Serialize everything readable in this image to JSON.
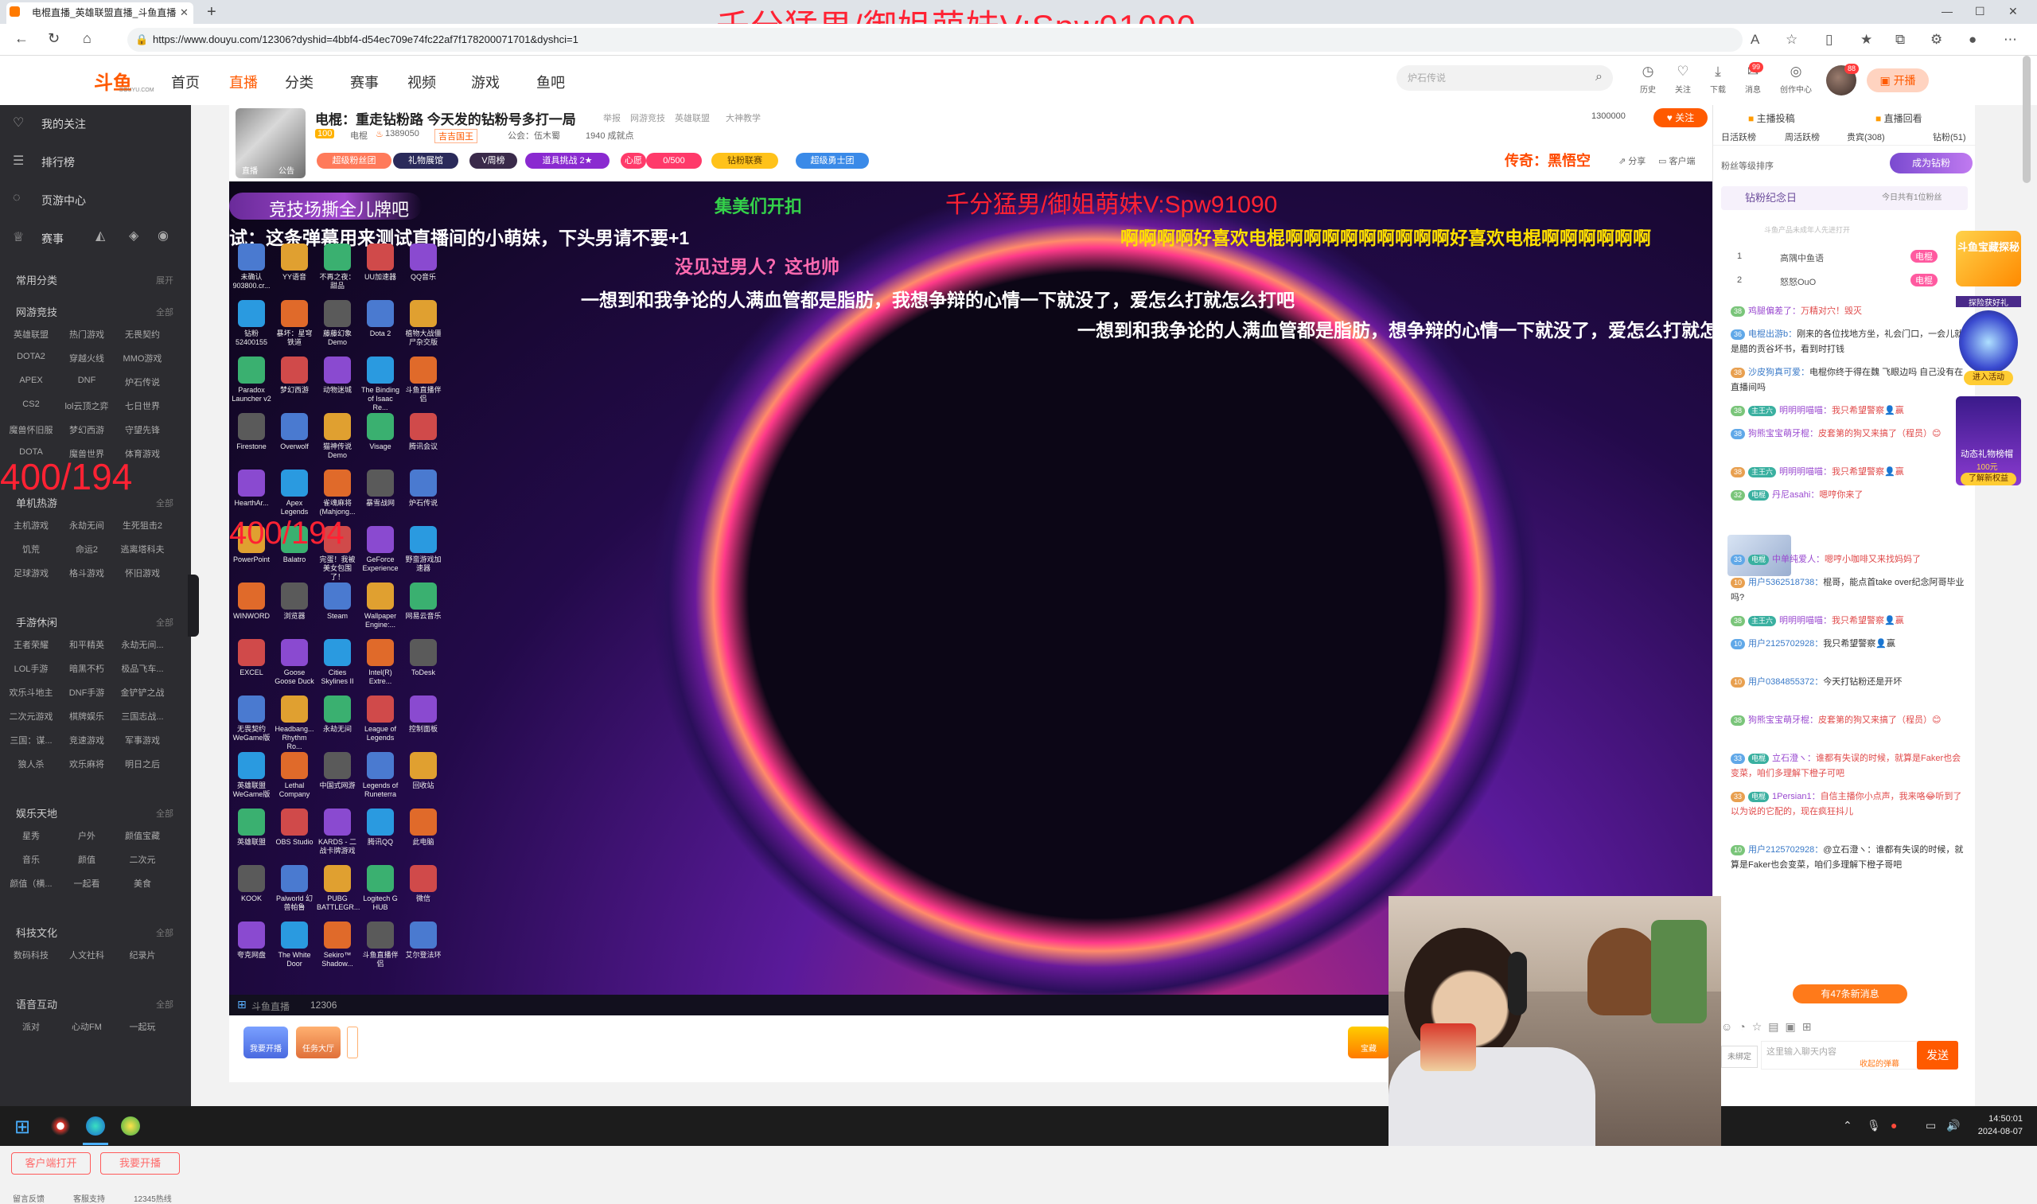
{
  "browser": {
    "tab_title": "电棍直播_英雄联盟直播_斗鱼直播",
    "url": "https://www.douyu.com/12306?dyshid=4bbf4-d54ec709e74fc22af7f178200071701&dyshci=1",
    "overlay_banner": "千分猛男/御姐萌妹V:Spw91090"
  },
  "site": {
    "logo": "斗鱼",
    "logo_sub": "DOUYU.COM",
    "nav": [
      "首页",
      "直播",
      "分类",
      "赛事",
      "视频",
      "游戏",
      "鱼吧"
    ],
    "search_placeholder": "炉石传说",
    "header_icons": [
      {
        "label": "历史",
        "icon": "clock-icon"
      },
      {
        "label": "关注",
        "icon": "heart-icon"
      },
      {
        "label": "下载",
        "icon": "download-icon"
      },
      {
        "label": "消息",
        "icon": "message-icon",
        "badge": "99"
      },
      {
        "label": "创作中心",
        "icon": "creator-icon"
      }
    ],
    "avatar_badge": "88",
    "start_live": "开播"
  },
  "sidebar": {
    "top_items": [
      {
        "label": "我的关注",
        "icon": "heart-icon"
      },
      {
        "label": "排行榜",
        "icon": "rank-icon"
      },
      {
        "label": "页游中心",
        "icon": "game-center-icon"
      },
      {
        "label": "赛事",
        "icon": "trophy-icon"
      }
    ],
    "common": {
      "title": "常用分类",
      "all": "展开"
    },
    "sections": [
      {
        "title": "网游竞技",
        "all": "全部",
        "items": [
          "英雄联盟",
          "热门游戏",
          "无畏契约",
          "DOTA2",
          "穿越火线",
          "MMO游戏",
          "APEX",
          "DNF",
          "炉石传说",
          "CS2",
          "lol云顶之弈",
          "七日世界",
          "魔兽怀旧服",
          "梦幻西游",
          "守望先锋",
          "DOTA",
          "魔兽世界",
          "体育游戏"
        ]
      },
      {
        "title": "单机热游",
        "all": "全部",
        "items": [
          "主机游戏",
          "永劫无间",
          "生死狙击2",
          "饥荒",
          "命运2",
          "逃离塔科夫",
          "足球游戏",
          "格斗游戏",
          "怀旧游戏"
        ]
      },
      {
        "title": "手游休闲",
        "all": "全部",
        "items": [
          "王者荣耀",
          "和平精英",
          "永劫无间...",
          "LOL手游",
          "暗黑不朽",
          "极品飞车...",
          "欢乐斗地主",
          "DNF手游",
          "金铲铲之战",
          "二次元游戏",
          "棋牌娱乐",
          "三国志战...",
          "三国：谋...",
          "竞速游戏",
          "军事游戏",
          "狼人杀",
          "欢乐麻将",
          "明日之后"
        ]
      },
      {
        "title": "娱乐天地",
        "all": "全部",
        "items": [
          "星秀",
          "户外",
          "颜值宝藏",
          "音乐",
          "颜值",
          "二次元",
          "颜值（横...",
          "一起看",
          "美食"
        ]
      },
      {
        "title": "科技文化",
        "all": "全部",
        "items": [
          "数码科技",
          "人文社科",
          "纪录片"
        ]
      },
      {
        "title": "语音互动",
        "all": "全部",
        "items": [
          "派对",
          "心动FM",
          "一起玩"
        ]
      }
    ],
    "red_overlay_1": "400/194",
    "red_overlay_2": "400/194",
    "btn_client": "客户端打开",
    "btn_start": "我要开播",
    "footer": [
      "留言反馈",
      "客服支持",
      "12345热线"
    ]
  },
  "room": {
    "title": "电棍：重走钻粉路 今天发的钻粉号多打一局",
    "report": "举报",
    "tags": [
      "网游竞技",
      "英雄联盟",
      "大神教学"
    ],
    "level": "100",
    "name": "电棍",
    "heat": "1389050",
    "guild": "吉吉国王",
    "notice": "公会：伍木蜀",
    "achievement": "1940 成就点",
    "thumb_labels": [
      "直播",
      "公告"
    ],
    "pills": [
      "超级粉丝团",
      "礼物展馆",
      "V周榜",
      "道具挑战 2★",
      "心愿",
      "0/500",
      "钻粉联赛",
      "超级勇士团"
    ],
    "followers": "1300000",
    "follow_btn": "关注",
    "legend_tag": "传奇：黑悟空",
    "share": "分享",
    "client": "客户端"
  },
  "video": {
    "banner": "竞技场撕全儿牌吧",
    "header_text": "集美们开扣",
    "title_overlay": "千分猛男/御姐萌妹V:Spw91090",
    "danmu": [
      {
        "text": "试：这条弹幕用来测试直播间的小萌妹，下头男请不要+1",
        "color": "#ffffff"
      },
      {
        "text": "啊啊啊啊好喜欢电棍啊啊啊啊啊啊啊啊啊好喜欢电棍啊啊啊啊啊啊",
        "color": "#ffe000"
      },
      {
        "text": "没见过男人？这也帅",
        "color": "#ff6ab0"
      },
      {
        "text": "一想到和我争论的人满血管都是脂肪，我想争辩的心情一下就没了，爱怎么打就怎么打吧",
        "color": "#ffffff"
      },
      {
        "text": "一想到和我争论的人满血管都是脂肪，想争辩的心情一下就没了，爱怎么打就怎么打吧",
        "color": "#ffffff"
      }
    ],
    "desktop_icons": [
      [
        "未确认 903800.cr...",
        "YY语音",
        "不再之夜：甜品",
        "UU加速器",
        "QQ音乐"
      ],
      [
        "钻粉 52400155",
        "暴坏：星穹铁道",
        "藤藤幻象 Demo",
        "Dota 2",
        "植物大战僵尸杂交版"
      ],
      [
        "Paradox Launcher v2",
        "梦幻西游",
        "动物迷城",
        "The Binding of Isaac Re...",
        "斗鱼直播伴侣"
      ],
      [
        "Firestone",
        "Overwolf",
        "猫神传说 Demo",
        "Visage",
        "腾讯会议"
      ],
      [
        "HearthAr...",
        "Apex Legends",
        "雀魂麻将 (Mahjong...",
        "暴雪战网",
        "炉石传说"
      ],
      [
        "PowerPoint",
        "Balatro",
        "完蛋！我被美女包围了！",
        "GeForce Experience",
        "野蛮游戏加速器"
      ],
      [
        "WINWORD",
        "浏览器",
        "Steam",
        "Wallpaper Engine:...",
        "网易云音乐"
      ],
      [
        "EXCEL",
        "Goose Goose Duck",
        "Cities Skylines II",
        "Intel(R) Extre...",
        "ToDesk"
      ],
      [
        "无畏契约 WeGame版",
        "Headbang... Rhythm Ro...",
        "永劫无间",
        "League of Legends",
        "控制面板"
      ],
      [
        "英雄联盟 WeGame版",
        "Lethal Company",
        "中国式网游",
        "Legends of Runeterra",
        "回收站"
      ],
      [
        "英雄联盟",
        "OBS Studio",
        "KARDS - 二战卡牌游戏",
        "腾讯QQ",
        "此电脑"
      ],
      [
        "KOOK",
        "Palworld 幻兽帕鲁",
        "PUBG BATTLEGR...",
        "Logitech G HUB",
        "微信"
      ],
      [
        "夸克网盘",
        "The White Door",
        "Sekiro™ Shadow...",
        "斗鱼直播伴侣",
        "艾尔登法环"
      ]
    ],
    "inner_taskbar_text": "12306",
    "inner_taskbar_label": "斗鱼直播"
  },
  "below_video": {
    "btn1": "我要开播",
    "btn2": "任务大厅",
    "right_tag": "宝藏"
  },
  "right": {
    "top_links": [
      "主播投稿",
      "直播回看"
    ],
    "tabs": [
      "日活跃榜",
      "周活跃榜",
      "贵宾(308)",
      "钻粉(51)"
    ],
    "fan_sort": "粉丝等级排序",
    "fan_btn": "成为钻粉",
    "memorial": "钻粉纪念日",
    "memorial_sub": "今日共有1位粉丝",
    "entering": "斗鱼产品未成年人先进打开",
    "ranks": [
      {
        "n": "1",
        "name": "高隅中鱼语",
        "tag": "电棍"
      },
      {
        "n": "2",
        "name": "怒怒OuO",
        "tag": "电棍"
      }
    ],
    "chat": [
      {
        "lv": "38",
        "name": "鸡腿偏差了：",
        "msg": "万精对穴！毁灭",
        "cls": "msg"
      },
      {
        "lv": "36",
        "name": "电棍出游b：",
        "msg": "刚来的各位找地方坐，礼会门口，一会儿就是腊的贡谷坏书，看到时打钱",
        "cls": "msgb"
      },
      {
        "lv": "38",
        "name": "沙皮狗真可爱：",
        "msg": "电棍你终于得在魏 飞眼边吗 自己没有在直播间吗",
        "cls": "msgb"
      },
      {
        "lv": "38",
        "badge": "主王六",
        "name": "明明明喵喵：",
        "msg": "我只希望警察👤赢",
        "cls": "msg"
      },
      {
        "lv": "38",
        "name": "狗熊宝宝萌牙棍：",
        "msg": "皮套第的狗又来搞了（程员）😊",
        "cls": "msg"
      },
      {
        "lv": "38",
        "badge": "主王六",
        "name": "明明明喵喵：",
        "msg": "我只希望警察👤赢",
        "cls": "msg"
      },
      {
        "lv": "32",
        "badge": "电棍",
        "name": "丹尼asahi：",
        "msg": "嗯哼你来了",
        "cls": "msg"
      },
      {
        "lv": "33",
        "badge": "电棍",
        "name": "中单纯爱人：",
        "msg": "嗯哼小咖啡又来找妈妈了",
        "cls": "msg"
      },
      {
        "lv": "10",
        "name": "用户5362518738：",
        "msg": "棍哥，能点首take over纪念阿哥毕业吗?",
        "cls": "msgb"
      },
      {
        "lv": "38",
        "badge": "主王六",
        "name": "明明明喵喵：",
        "msg": "我只希望警察👤赢",
        "cls": "msg"
      },
      {
        "lv": "10",
        "name": "用户2125702928：",
        "msg": "我只希望警察👤赢",
        "cls": "msgb"
      },
      {
        "lv": "10",
        "name": "用户0384855372：",
        "msg": "今天打钻粉还是开坏",
        "cls": "msgb"
      },
      {
        "lv": "38",
        "name": "狗熊宝宝萌牙棍：",
        "msg": "皮套第的狗又来搞了（程员）😊",
        "cls": "msg"
      },
      {
        "lv": "33",
        "badge": "电棍",
        "name": "立石澄ヽ：",
        "msg": "谁都有失误的时候，就算是Faker也会变菜，咱们多理解下橙子可吧",
        "cls": "msg"
      },
      {
        "lv": "33",
        "badge": "电棍",
        "name": "1Persian1：",
        "msg": "自信主播你小点声，我来咯😂听到了以为说的它配的，现在疯狂抖儿",
        "cls": "msg"
      },
      {
        "lv": "10",
        "name": "用户2125702928：",
        "msg": "@立石澄ヽ：谁都有失误的时候，就算是Faker也会变菜，咱们多理解下橙子哥吧",
        "cls": "msgb"
      }
    ],
    "new_msgs": "有47条新消息",
    "chat_placeholder": "这里输入聊天内容",
    "bubble": "收起的弹幕",
    "send": "发送",
    "not_bound": "未绑定",
    "ad_top": "斗鱼宝藏探秘",
    "ad_btn": "进入活动",
    "ad_mid": "动态礼物榜帽",
    "ad_price": "100元",
    "ad_learn": "了解新权益",
    "ad_label": "探险获好礼"
  },
  "taskbar": {
    "time": "14:50:01",
    "date": "2024-08-07"
  }
}
